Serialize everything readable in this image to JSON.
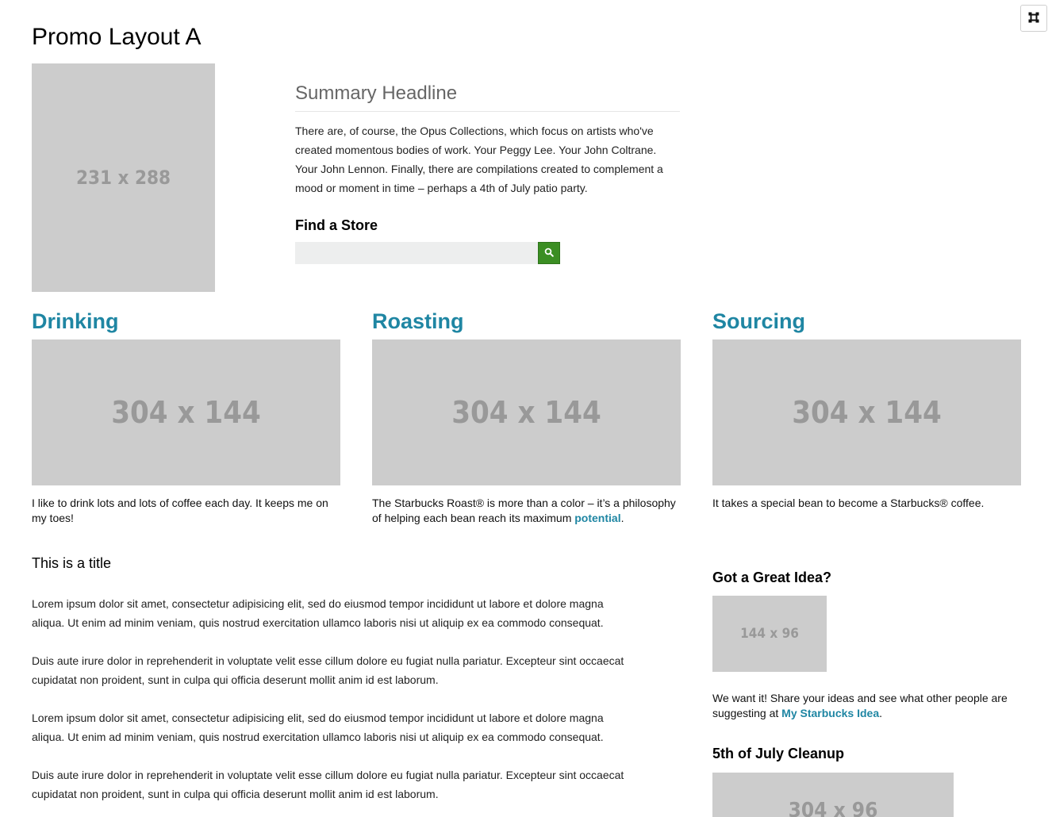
{
  "page": {
    "title": "Promo Layout A",
    "corner_icon": "fullscreen-icon"
  },
  "hero": {
    "image_label": "231 x 288",
    "headline": "Summary Headline",
    "summary": "There are, of course, the Opus Collections, which focus on artists who've created momentous bodies of work. Your Peggy Lee. Your John Coltrane. Your John Lennon. Finally, there are compilations created to complement a mood or moment in time – perhaps a 4th of July patio party."
  },
  "find_store": {
    "heading": "Find a Store",
    "input_value": "",
    "search_icon": "search-icon"
  },
  "columns": [
    {
      "title": "Drinking",
      "image_label": "304 x 144",
      "text": "I like to drink lots and lots of coffee each day. It keeps me on my toes!"
    },
    {
      "title": "Roasting",
      "image_label": "304 x 144",
      "text_before": "The Starbucks Roast® is more than a color – it’s a philosophy of helping each bean reach its maximum ",
      "link": "potential",
      "text_after": "."
    },
    {
      "title": "Sourcing",
      "image_label": "304 x 144",
      "text": "It takes a special bean to become a Starbucks® coffee."
    }
  ],
  "article": {
    "title": "This is a title",
    "paragraphs": [
      "Lorem ipsum dolor sit amet, consectetur adipisicing elit, sed do eiusmod tempor incididunt ut labore et dolore magna aliqua. Ut enim ad minim veniam, quis nostrud exercitation ullamco laboris nisi ut aliquip ex ea commodo consequat.",
      "Duis aute irure dolor in reprehenderit in voluptate velit esse cillum dolore eu fugiat nulla pariatur. Excepteur sint occaecat cupidatat non proident, sunt in culpa qui officia deserunt mollit anim id est laborum.",
      "Lorem ipsum dolor sit amet, consectetur adipisicing elit, sed do eiusmod tempor incididunt ut labore et dolore magna aliqua. Ut enim ad minim veniam, quis nostrud exercitation ullamco laboris nisi ut aliquip ex ea commodo consequat.",
      "Duis aute irure dolor in reprehenderit in voluptate velit esse cillum dolore eu fugiat nulla pariatur. Excepteur sint occaecat cupidatat non proident, sunt in culpa qui officia deserunt mollit anim id est laborum."
    ]
  },
  "sidebar": {
    "idea": {
      "title": "Got a Great Idea?",
      "image_label": "144 x 96",
      "text_before": "We want it! Share your ideas and see what other people are suggesting at ",
      "link": "My Starbucks Idea",
      "text_after": "."
    },
    "cleanup": {
      "title": "5th of July Cleanup",
      "image_label": "304 x 96"
    }
  },
  "colors": {
    "accent": "#1f86a3",
    "button_green": "#3b8e23",
    "placeholder_bg": "#cccccc",
    "placeholder_text": "#999999"
  }
}
